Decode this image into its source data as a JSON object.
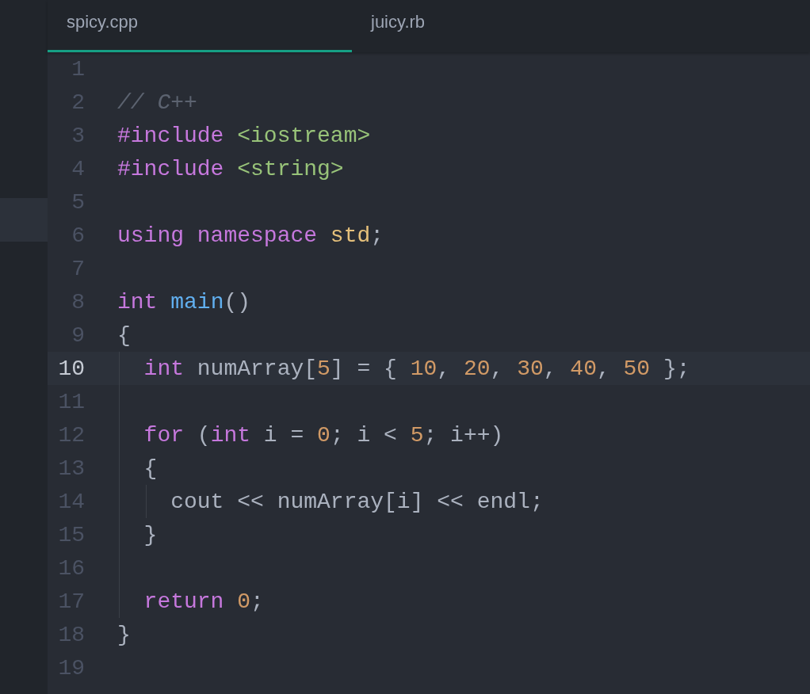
{
  "tabs": [
    {
      "label": "spicy.cpp",
      "selected": true
    },
    {
      "label": "juicy.rb",
      "selected": false
    }
  ],
  "editor": {
    "lines": [
      {
        "number": "1",
        "current": false
      },
      {
        "number": "2",
        "current": false,
        "tokens": [
          {
            "kind": "comment",
            "text": "// C++"
          }
        ]
      },
      {
        "number": "3",
        "current": false,
        "tokens": [
          {
            "kind": "keyword",
            "text": "#include"
          },
          {
            "kind": "string",
            "text": " <iostream>"
          }
        ]
      },
      {
        "number": "4",
        "current": false,
        "tokens": [
          {
            "kind": "keyword",
            "text": "#include"
          },
          {
            "kind": "string",
            "text": " <string>"
          }
        ]
      },
      {
        "number": "5",
        "current": false
      },
      {
        "number": "6",
        "current": false,
        "tokens": [
          {
            "kind": "keyword",
            "text": "using"
          },
          {
            "kind": "keyword",
            "text": " namespace"
          },
          {
            "kind": "type",
            "text": " std"
          },
          {
            "kind": "plain",
            "text": ";"
          }
        ]
      },
      {
        "number": "7",
        "current": false
      },
      {
        "number": "8",
        "current": false,
        "tokens": [
          {
            "kind": "keyword",
            "text": "int"
          },
          {
            "kind": "function",
            "text": " main"
          },
          {
            "kind": "plain",
            "text": "()"
          }
        ]
      },
      {
        "number": "9",
        "current": false,
        "tokens": [
          {
            "kind": "plain",
            "text": "{"
          }
        ]
      },
      {
        "number": "10",
        "current": true,
        "tokens": [
          {
            "kind": "keyword",
            "text": "  int"
          },
          {
            "kind": "plain",
            "text": " numArray["
          },
          {
            "kind": "number",
            "text": "5"
          },
          {
            "kind": "plain",
            "text": "] = { "
          },
          {
            "kind": "number",
            "text": "10"
          },
          {
            "kind": "plain",
            "text": ", "
          },
          {
            "kind": "number",
            "text": "20"
          },
          {
            "kind": "plain",
            "text": ", "
          },
          {
            "kind": "number",
            "text": "30"
          },
          {
            "kind": "plain",
            "text": ", "
          },
          {
            "kind": "number",
            "text": "40"
          },
          {
            "kind": "plain",
            "text": ", "
          },
          {
            "kind": "number",
            "text": "50"
          },
          {
            "kind": "plain",
            "text": " };"
          }
        ]
      },
      {
        "number": "11",
        "current": false
      },
      {
        "number": "12",
        "current": false,
        "tokens": [
          {
            "kind": "keyword",
            "text": "  for"
          },
          {
            "kind": "plain",
            "text": " ("
          },
          {
            "kind": "keyword",
            "text": "int"
          },
          {
            "kind": "plain",
            "text": " i = "
          },
          {
            "kind": "number",
            "text": "0"
          },
          {
            "kind": "plain",
            "text": "; i < "
          },
          {
            "kind": "number",
            "text": "5"
          },
          {
            "kind": "plain",
            "text": "; i++)"
          }
        ]
      },
      {
        "number": "13",
        "current": false,
        "tokens": [
          {
            "kind": "plain",
            "text": "  {"
          }
        ]
      },
      {
        "number": "14",
        "current": false,
        "tokens": [
          {
            "kind": "plain",
            "text": "    cout << numArray[i] << endl;"
          }
        ]
      },
      {
        "number": "15",
        "current": false,
        "tokens": [
          {
            "kind": "plain",
            "text": "  }"
          }
        ]
      },
      {
        "number": "16",
        "current": false
      },
      {
        "number": "17",
        "current": false,
        "tokens": [
          {
            "kind": "keyword",
            "text": "  return"
          },
          {
            "kind": "number",
            "text": " 0"
          },
          {
            "kind": "plain",
            "text": ";"
          }
        ]
      },
      {
        "number": "18",
        "current": false,
        "tokens": [
          {
            "kind": "plain",
            "text": "}"
          }
        ]
      },
      {
        "number": "19",
        "current": false
      }
    ]
  }
}
